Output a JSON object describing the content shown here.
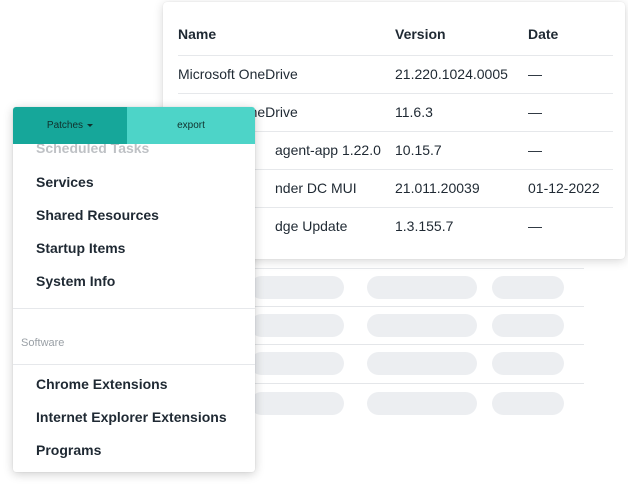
{
  "table": {
    "headers": {
      "name": "Name",
      "version": "Version",
      "date": "Date"
    },
    "rows": [
      {
        "name": "Microsoft OneDrive",
        "version": "21.220.1024.0005",
        "date": "—"
      },
      {
        "name": "Microsoft OneDrive",
        "version": "11.6.3",
        "date": "—"
      },
      {
        "name": "agent-app 1.22.0",
        "version": "10.15.7",
        "date": "—"
      },
      {
        "name": "nder DC MUI",
        "version": "21.011.20039",
        "date": "01-12-2022"
      },
      {
        "name": "dge Update",
        "version": "1.3.155.7",
        "date": "—"
      }
    ]
  },
  "dropdown": {
    "tabs": {
      "patches": "Patches",
      "export": "export"
    },
    "faded_item": "Scheduled Tasks",
    "items": [
      "Services",
      "Shared Resources",
      "Startup Items",
      "System Info"
    ],
    "section_label": "Software",
    "software_items": [
      "Chrome Extensions",
      "Internet Explorer Extensions",
      "Programs"
    ]
  },
  "colors": {
    "tab_active": "#16a79a",
    "tab_inactive": "#4dd4c8",
    "text": "#1f2933",
    "skeleton": "#eceef1"
  }
}
